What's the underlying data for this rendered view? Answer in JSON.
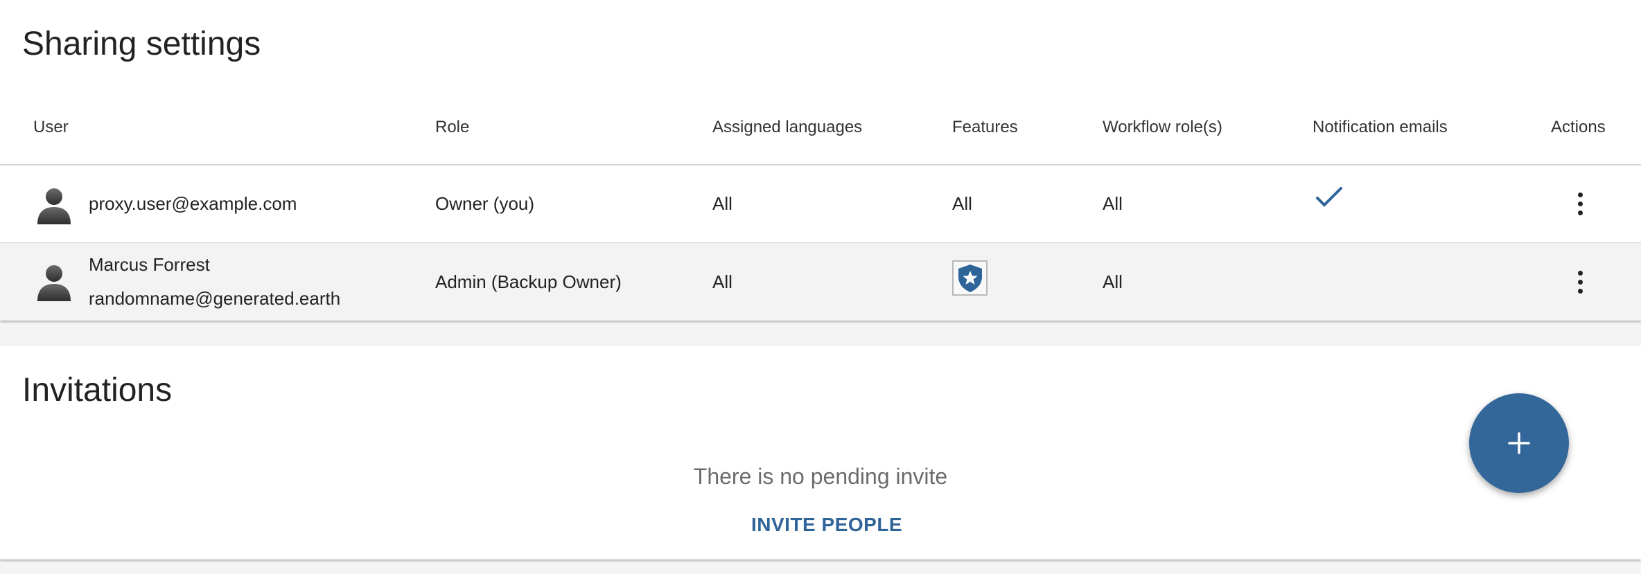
{
  "sharing": {
    "title": "Sharing settings",
    "columns": [
      "User",
      "Role",
      "Assigned languages",
      "Features",
      "Workflow role(s)",
      "Notification emails",
      "Actions"
    ],
    "rows": [
      {
        "user_email": "proxy.user@example.com",
        "role": "Owner (you)",
        "languages": "All",
        "features": "All",
        "workflow": "All",
        "notification_emails": true
      },
      {
        "user_name": "Marcus Forrest",
        "user_email": "randomname@generated.earth",
        "role": "Admin (Backup Owner)",
        "languages": "All",
        "features_icon": "shield-star-icon",
        "workflow": "All",
        "notification_emails": false
      }
    ]
  },
  "invitations": {
    "title": "Invitations",
    "empty_text": "There is no pending invite",
    "invite_label": "INVITE PEOPLE"
  },
  "fab": {
    "icon": "plus-icon"
  },
  "colors": {
    "accent": "#336699",
    "link": "#2f6499",
    "row_alt_bg": "#f3f3f3"
  }
}
